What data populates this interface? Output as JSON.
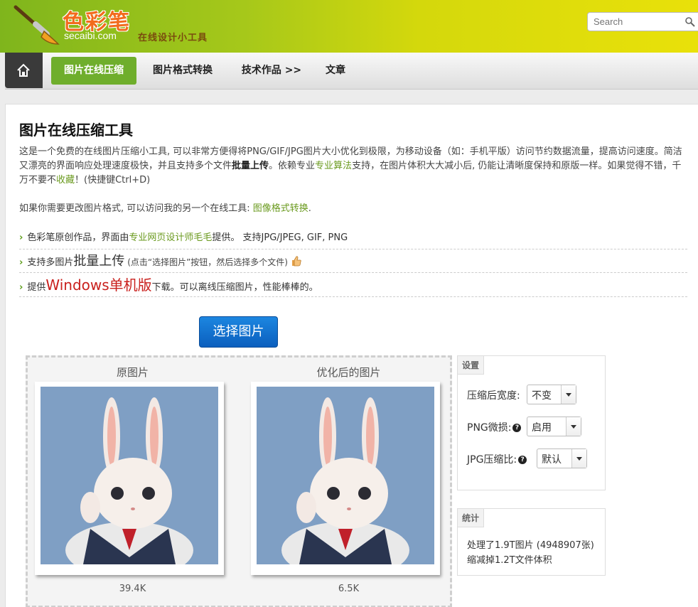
{
  "header": {
    "logo_cn": "色彩笔",
    "logo_en": "secaibi.com",
    "slogan": "在线设计小工具",
    "search_placeholder": "Search"
  },
  "nav": {
    "items": [
      {
        "label": "图片在线压缩",
        "active": true
      },
      {
        "label": "图片格式转换"
      },
      {
        "label": "技术作品 >>"
      },
      {
        "label": "文章"
      }
    ]
  },
  "main": {
    "title": "图片在线压缩工具",
    "intro": {
      "p1": "这是一个免费的在线图片压缩小工具, 可以非常方便得将PNG/GIF/JPG图片大小优化到极限，为移动设备（如：手机平版）访问节约数据流量，提高访问速度。简洁又漂亮的界面响应处理速度极快，并且支持多个文件",
      "p1_bold": "批量上传",
      "p2": "。依赖专业",
      "p2_link": "专业算法",
      "p3": "支持，在图片体积大大减小后, 仍能让清晰度保持和原版一样。如果觉得不错，千万不要不",
      "p3_link": "收藏",
      "p4": "！(快捷键Ctrl+D)"
    },
    "intro2": {
      "text": "如果你需要更改图片格式, 可以访问我的另一个在线工具: ",
      "link": "图像格式转换",
      "end": "."
    },
    "features": [
      {
        "pre": "色彩笔原创作品，界面由",
        "link": "专业网页设计师毛毛",
        "post": "提供。 支持JPG/JPEG, GIF, PNG"
      },
      {
        "pre": "支持多图片",
        "big": "批量上传",
        "small": " (点击“选择图片”按钮，然后选择多个文件)"
      },
      {
        "pre": "提供",
        "red": "Windows单机版",
        "post": "下载。可以离线压缩图片，性能棒棒的。"
      }
    ],
    "choose_button": "选择图片"
  },
  "compare": {
    "original_label": "原图片",
    "optimized_label": "优化后的图片",
    "original_size": "39.4K",
    "optimized_size": "6.5K"
  },
  "settings": {
    "tab": "设置",
    "width_label": "压缩后宽度:",
    "width_value": "不变",
    "png_label": "PNG微损:",
    "png_value": "启用",
    "jpg_label": "JPG压缩比:",
    "jpg_value": "默认"
  },
  "stats": {
    "tab": "统计",
    "line1": "处理了1.9T图片 (4948907张)",
    "line2": "缩减掉1.2T文件体积"
  }
}
